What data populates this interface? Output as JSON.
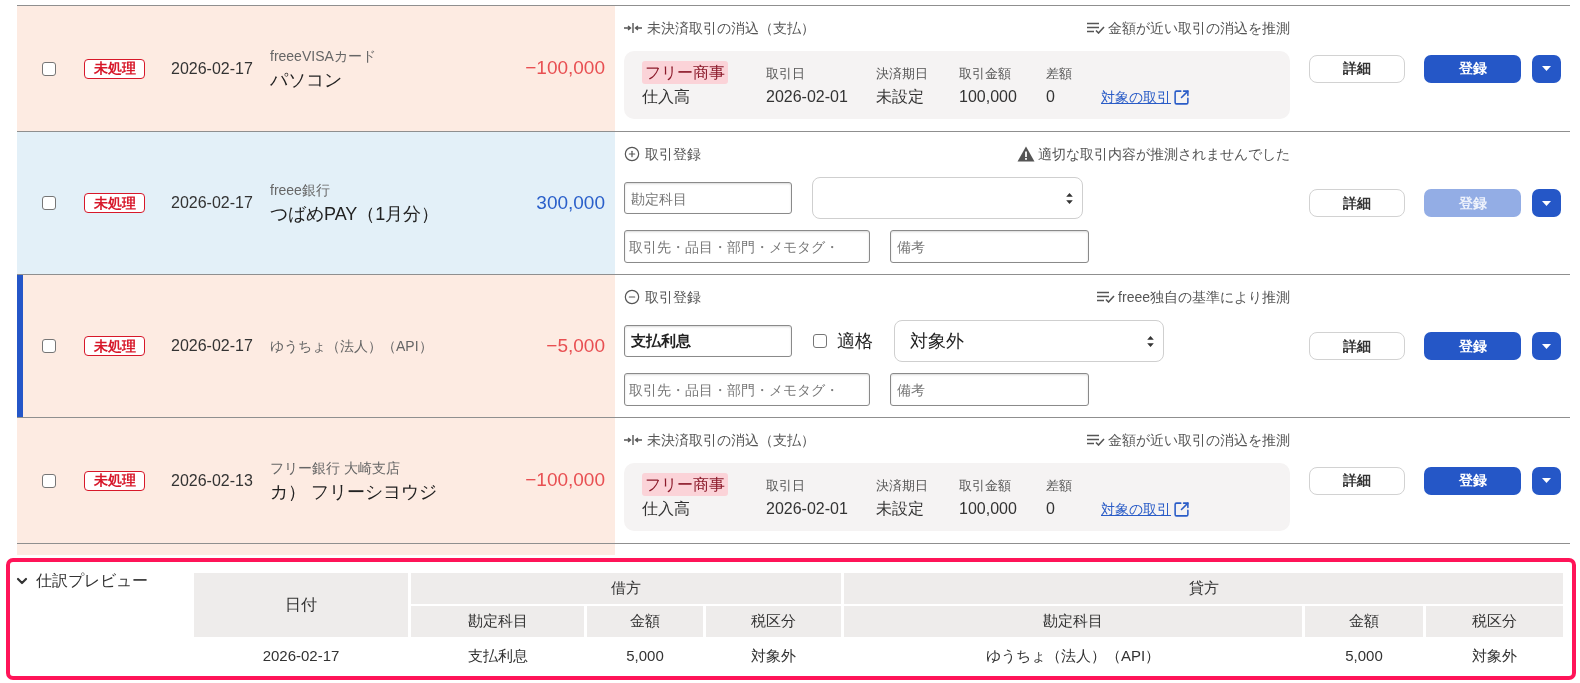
{
  "rows": [
    {
      "kind": "expense",
      "selected": false,
      "checked": false,
      "status": "未処理",
      "date": "2026-02-17",
      "account": "freeeVISAカード",
      "description": "パソコン",
      "amount": "−100,000",
      "panel": {
        "kind": "match",
        "title": "未決済取引の消込（支払）",
        "hint": {
          "kind": "guess",
          "text": "金額が近い取引の消込を推測"
        },
        "partner": "フリー商事",
        "item": "仕入高",
        "fields": [
          {
            "label": "取引日",
            "value": "2026-02-01"
          },
          {
            "label": "決済期日",
            "value": "未設定"
          },
          {
            "label": "取引金額",
            "value": "100,000"
          },
          {
            "label": "差額",
            "value": "0"
          }
        ],
        "link": "対象の取引"
      },
      "detail_button": "詳細",
      "register_button": {
        "label": "登録",
        "disabled": false
      }
    },
    {
      "kind": "income",
      "selected": false,
      "checked": false,
      "status": "未処理",
      "date": "2026-02-17",
      "account": "freee銀行",
      "description": "つばめPAY（1月分）",
      "amount": "300,000",
      "panel": {
        "kind": "register",
        "expanded": false,
        "title": "取引登録",
        "hint": {
          "kind": "warning",
          "text": "適切な取引内容が推測されませんでした"
        },
        "account_field": {
          "placeholder": "勘定科目"
        },
        "partner_field": {
          "placeholder": "取引先・品目・部門・メモタグ・"
        },
        "memo_field": {
          "placeholder": "備考"
        }
      },
      "detail_button": "詳細",
      "register_button": {
        "label": "登録",
        "disabled": true
      }
    },
    {
      "kind": "expense",
      "selected": true,
      "checked": false,
      "status": "未処理",
      "date": "2026-02-17",
      "account": "ゆうちょ（法人）（API）",
      "amount": "−5,000",
      "panel": {
        "kind": "register",
        "expanded": true,
        "title": "取引登録",
        "hint": {
          "kind": "guess",
          "text": "freee独自の基準により推測"
        },
        "account_field": {
          "value": "支払利息"
        },
        "qualified": {
          "label": "適格",
          "checked": false
        },
        "tax_select": {
          "value": "対象外"
        },
        "partner_field": {
          "placeholder": "取引先・品目・部門・メモタグ・"
        },
        "memo_field": {
          "placeholder": "備考"
        }
      },
      "detail_button": "詳細",
      "register_button": {
        "label": "登録",
        "disabled": false
      }
    },
    {
      "kind": "expense",
      "selected": false,
      "checked": false,
      "status": "未処理",
      "date": "2026-02-13",
      "account": "フリー銀行 大崎支店",
      "description": "カ） フリーシヨウジ",
      "amount": "−100,000",
      "panel": {
        "kind": "match",
        "title": "未決済取引の消込（支払）",
        "hint": {
          "kind": "guess",
          "text": "金額が近い取引の消込を推測"
        },
        "partner": "フリー商事",
        "item": "仕入高",
        "fields": [
          {
            "label": "取引日",
            "value": "2026-02-01"
          },
          {
            "label": "決済期日",
            "value": "未設定"
          },
          {
            "label": "取引金額",
            "value": "100,000"
          },
          {
            "label": "差額",
            "value": "0"
          }
        ],
        "link": "対象の取引"
      },
      "detail_button": "詳細",
      "register_button": {
        "label": "登録",
        "disabled": false
      }
    }
  ],
  "preview": {
    "title": "仕訳プレビュー",
    "expanded": true,
    "date_header": "日付",
    "groups": [
      {
        "label": "借方",
        "columns": [
          "勘定科目",
          "金額",
          "税区分"
        ]
      },
      {
        "label": "貸方",
        "columns": [
          "勘定科目",
          "金額",
          "税区分"
        ]
      }
    ],
    "rows": [
      {
        "cells": [
          "2026-02-17",
          "支払利息",
          "5,000",
          "対象外",
          "ゆうちょ（法人）（API）",
          "5,000",
          "対象外"
        ]
      }
    ]
  }
}
